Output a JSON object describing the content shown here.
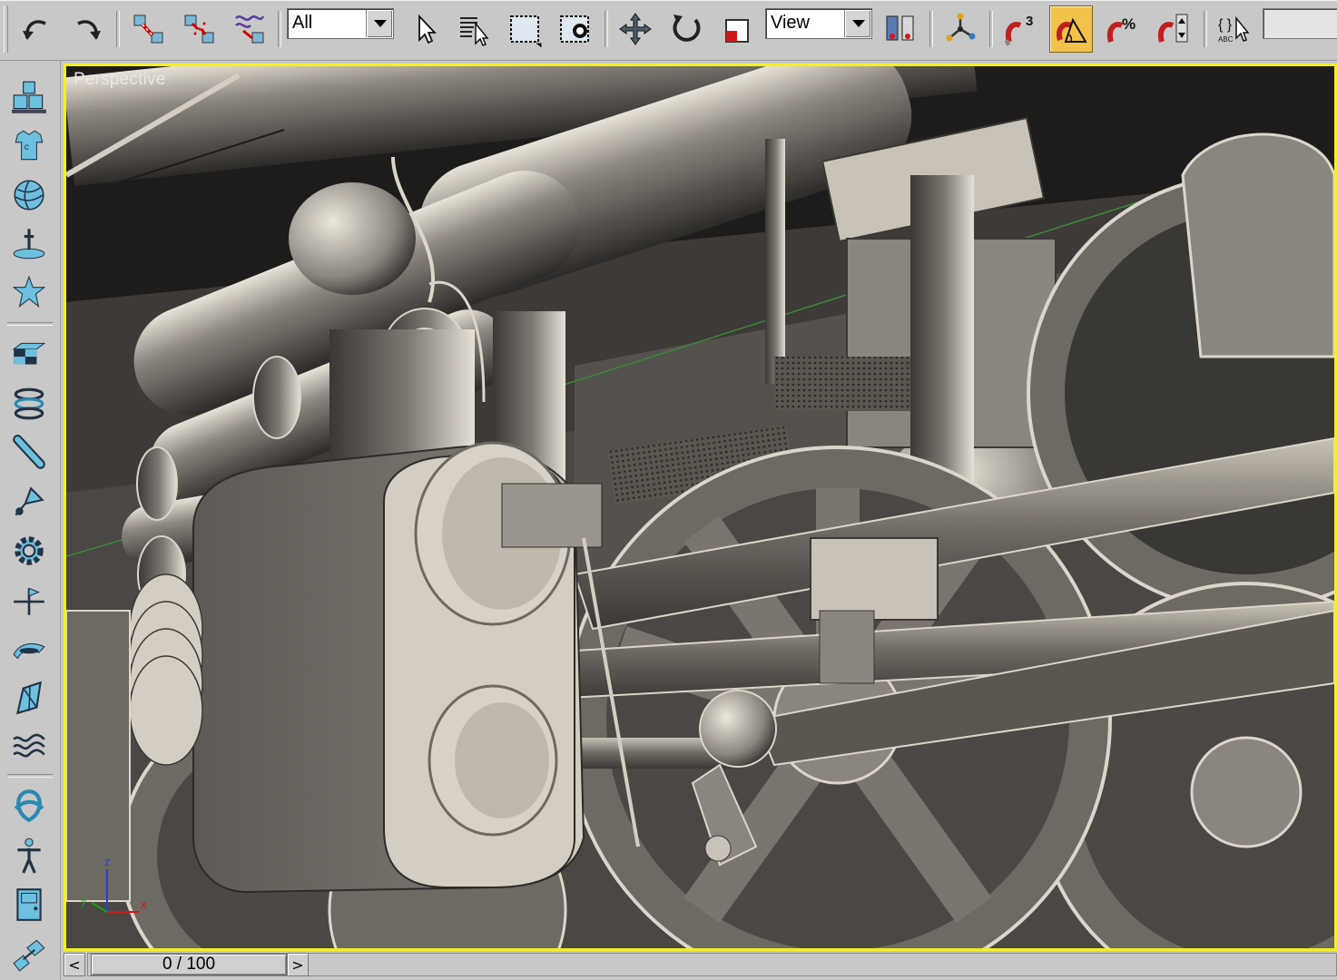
{
  "toolbar": {
    "selection_filter": {
      "value": "All",
      "options": [
        "All"
      ]
    },
    "reference_coord": {
      "value": "View",
      "options": [
        "View"
      ]
    },
    "buttons": [
      {
        "name": "undo-button",
        "icon": "undo-icon"
      },
      {
        "name": "redo-button",
        "icon": "redo-icon"
      },
      {
        "name": "select-and-link-button",
        "icon": "link-icon"
      },
      {
        "name": "unlink-selection-button",
        "icon": "unlink-icon"
      },
      {
        "name": "bind-to-space-warp-button",
        "icon": "space-warp-icon"
      },
      {
        "name": "select-object-button",
        "icon": "arrow-cursor-icon"
      },
      {
        "name": "select-by-name-button",
        "icon": "list-select-icon"
      },
      {
        "name": "rectangular-selection-button",
        "icon": "rect-selection-icon"
      },
      {
        "name": "window-crossing-button",
        "icon": "crossing-icon"
      },
      {
        "name": "select-and-move-button",
        "icon": "move-icon"
      },
      {
        "name": "select-and-rotate-button",
        "icon": "rotate-icon"
      },
      {
        "name": "select-and-scale-button",
        "icon": "scale-icon"
      },
      {
        "name": "pivot-center-button",
        "icon": "pivot-icon"
      },
      {
        "name": "select-and-manipulate-button",
        "icon": "manipulate-icon"
      },
      {
        "name": "snaps-toggle-button",
        "icon": "snap-3d-icon"
      },
      {
        "name": "angle-snap-toggle-button",
        "icon": "angle-snap-icon"
      },
      {
        "name": "percent-snap-toggle-button",
        "icon": "percent-snap-icon"
      },
      {
        "name": "spinner-snap-toggle-button",
        "icon": "spinner-snap-icon"
      },
      {
        "name": "edit-named-selections-button",
        "icon": "named-selection-icon"
      }
    ],
    "snap_label": "3",
    "percent_label": "%",
    "named_sel_label": "ABC",
    "braces_label": "{ }"
  },
  "command_bar": {
    "items": [
      {
        "name": "create-objects-icon"
      },
      {
        "name": "shapes-icon"
      },
      {
        "name": "sphere-icon"
      },
      {
        "name": "lights-icon"
      },
      {
        "name": "particles-icon"
      },
      {
        "name": "materials-icon"
      },
      {
        "name": "coil-icon"
      },
      {
        "name": "tube-icon"
      },
      {
        "name": "camera-icon"
      },
      {
        "name": "gear-icon"
      },
      {
        "name": "helpers-icon"
      },
      {
        "name": "space-warp-icon"
      },
      {
        "name": "deform-icon"
      },
      {
        "name": "wave-icon"
      },
      {
        "name": "knot-icon"
      },
      {
        "name": "biped-icon"
      },
      {
        "name": "door-icon"
      },
      {
        "name": "systems-icon"
      }
    ]
  },
  "viewport": {
    "label": "Perspective",
    "border_color": "#f4f01e",
    "axes": {
      "x": "x",
      "y": "y",
      "z": "z"
    }
  },
  "time_slider": {
    "label": "0 / 100",
    "current_frame": 0,
    "total_frames": 100,
    "prev_label": "<",
    "next_label": ">"
  },
  "colors": {
    "ui_gray": "#c8c8c8",
    "active_highlight": "#f2c24a",
    "model_light": "#e7e2d6",
    "model_dark": "#2b2927",
    "icon_blue": "#5ab4d8"
  }
}
